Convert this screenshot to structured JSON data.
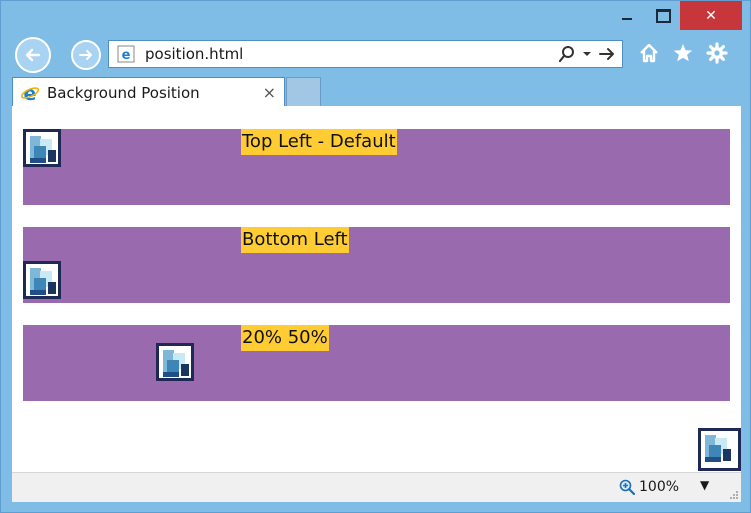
{
  "window": {
    "minimize": "minimize",
    "maximize": "maximize",
    "close": "✕"
  },
  "address": {
    "url": "position.html",
    "icons": [
      "ie-page-icon",
      "search-icon",
      "dropdown-icon",
      "go-arrow-icon"
    ]
  },
  "toolbar_icons": [
    "home-icon",
    "favorites-star-icon",
    "settings-gear-icon"
  ],
  "tab": {
    "title": "Background Position",
    "close": "×"
  },
  "bands": [
    {
      "label": "Top Left - Default"
    },
    {
      "label": "Bottom Left"
    },
    {
      "label": "20% 50%"
    }
  ],
  "status": {
    "zoom": "100%"
  },
  "colors": {
    "band": "#9a6aae",
    "label_bg": "#ffcc33",
    "chrome": "#7fbde6",
    "close": "#c7363a"
  }
}
